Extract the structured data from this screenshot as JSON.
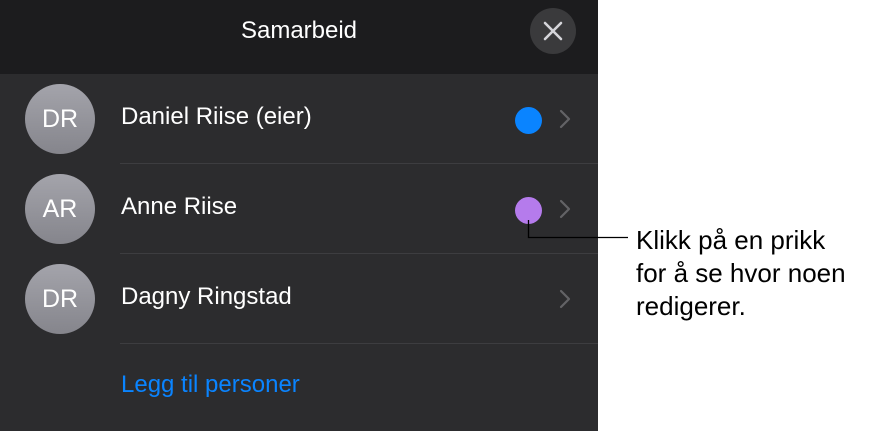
{
  "header": {
    "title": "Samarbeid",
    "close_icon": "close-icon"
  },
  "participants": [
    {
      "initials": "DR",
      "name": "Daniel Riise (eier)",
      "dot_color": "#0a84ff",
      "has_dot": true
    },
    {
      "initials": "AR",
      "name": "Anne Riise",
      "dot_color": "#b57bec",
      "has_dot": true
    },
    {
      "initials": "DR",
      "name": "Dagny Ringstad",
      "dot_color": "",
      "has_dot": false
    }
  ],
  "add_people": {
    "label": "Legg til personer"
  },
  "callout": {
    "lines": [
      "Klikk på en prikk",
      "for å se hvor noen",
      "redigerer."
    ]
  },
  "colors": {
    "panel_background": "#1c1c1e",
    "row_background": "#2c2c2e",
    "link_blue": "#0a84ff"
  }
}
